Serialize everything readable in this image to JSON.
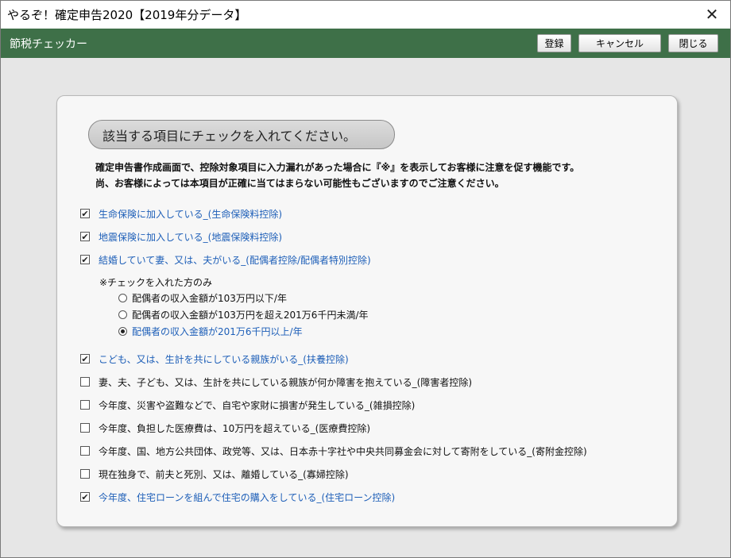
{
  "window": {
    "title": "やるぞ！確定申告2020【2019年分データ】",
    "close_glyph": "✕"
  },
  "toolbar": {
    "app_name": "節税チェッカー",
    "register_label": "登録",
    "cancel_label": "キャンセル",
    "close_label": "閉じる"
  },
  "panel": {
    "heading": "該当する項目にチェックを入れてください。",
    "description_line1": "確定申告書作成画面で、控除対象項目に入力漏れがあった場合に『※』を表示してお客様に注意を促す機能です。",
    "description_line2": "尚、お客様によっては本項目が正確に当てはまらない可能性もございますのでご注意ください。"
  },
  "check_mark": "✔",
  "items": [
    {
      "label": "生命保険に加入している_(生命保険料控除)",
      "checked": true
    },
    {
      "label": "地震保険に加入している_(地震保険料控除)",
      "checked": true
    },
    {
      "label": "結婚していて妻、又は、夫がいる_(配偶者控除/配偶者特別控除)",
      "checked": true
    },
    {
      "label": "こども、又は、生計を共にしている親族がいる_(扶養控除)",
      "checked": true
    },
    {
      "label": "妻、夫、子ども、又は、生計を共にしている親族が何か障害を抱えている_(障害者控除)",
      "checked": false
    },
    {
      "label": "今年度、災害や盗難などで、自宅や家財に損害が発生している_(雑損控除)",
      "checked": false
    },
    {
      "label": "今年度、負担した医療費は、10万円を超えている_(医療費控除)",
      "checked": false
    },
    {
      "label": "今年度、国、地方公共団体、政党等、又は、日本赤十字社や中央共同募金会に対して寄附をしている_(寄附金控除)",
      "checked": false
    },
    {
      "label": "現在独身で、前夫と死別、又は、離婚している_(寡婦控除)",
      "checked": false
    },
    {
      "label": "今年度、住宅ローンを組んで住宅の購入をしている_(住宅ローン控除)",
      "checked": true
    }
  ],
  "spouse_income": {
    "note": "※チェックを入れた方のみ",
    "options": [
      {
        "label": "配偶者の収入金額が103万円以下/年",
        "selected": false
      },
      {
        "label": "配偶者の収入金額が103万円を超え201万6千円未満/年",
        "selected": false
      },
      {
        "label": "配偶者の収入金額が201万6千円以上/年",
        "selected": true
      }
    ]
  },
  "colors": {
    "toolbar_green": "#3e7048",
    "checked_text": "#1e5fb8",
    "background": "#e6e6e6"
  }
}
